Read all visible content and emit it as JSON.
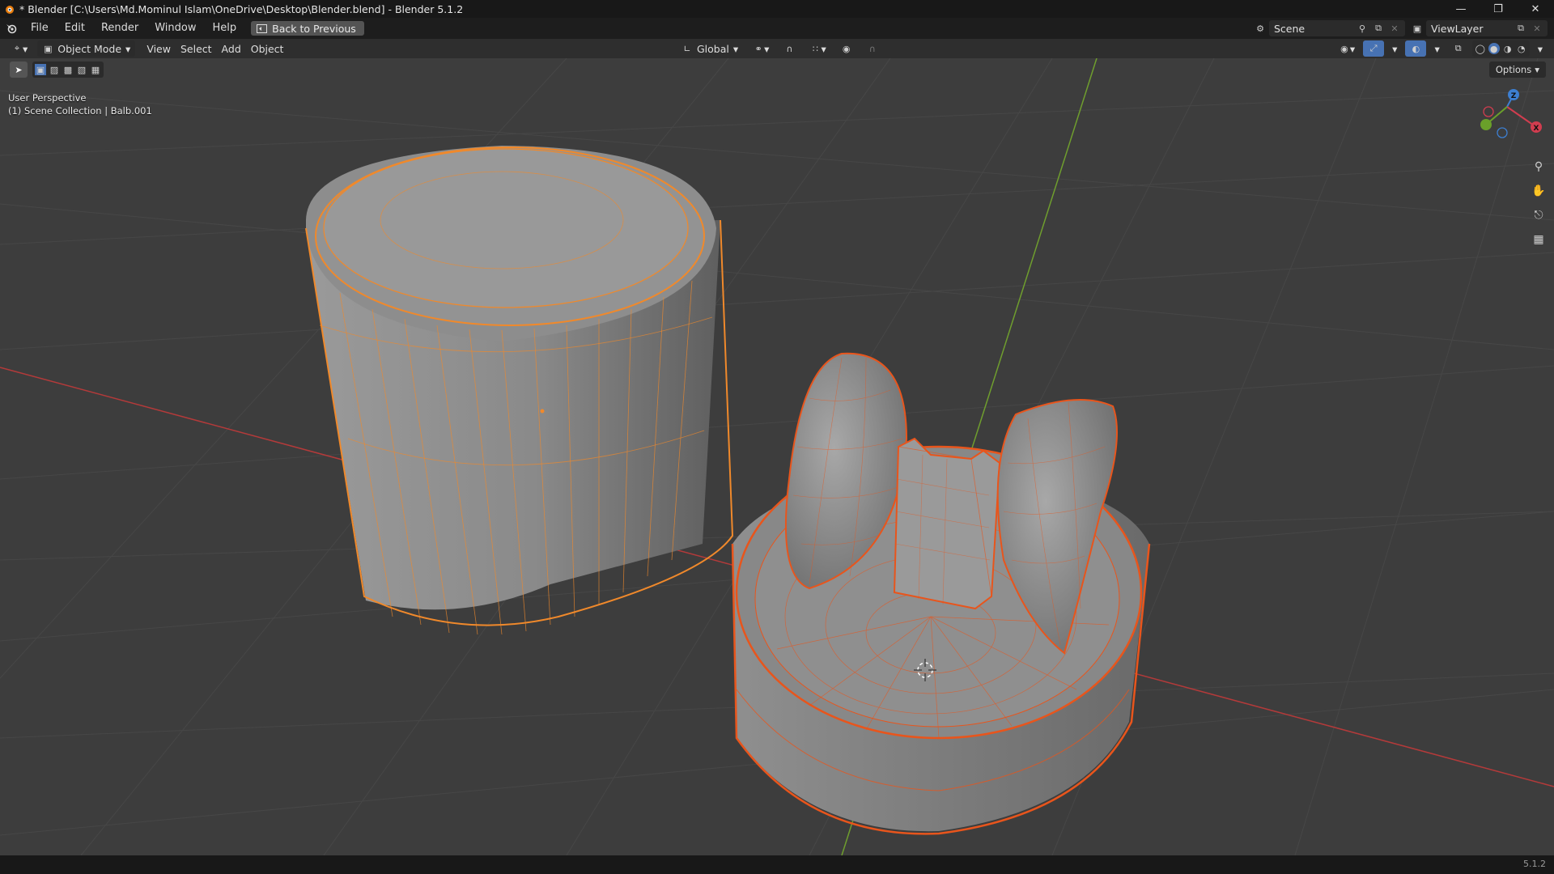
{
  "window": {
    "title": "* Blender [C:\\Users\\Md.Mominul Islam\\OneDrive\\Desktop\\Blender.blend] - Blender 5.1.2",
    "controls": [
      "minimize",
      "restore",
      "close"
    ]
  },
  "menubar": {
    "items": [
      "File",
      "Edit",
      "Render",
      "Window",
      "Help"
    ],
    "back_button": "Back to Previous",
    "scene": "Scene",
    "view_layer": "ViewLayer"
  },
  "viewport_header": {
    "mode": "Object Mode",
    "menus": [
      "View",
      "Select",
      "Add",
      "Object"
    ],
    "transform_orientation": "Global"
  },
  "viewport": {
    "perspective_label": "User Perspective",
    "collection_label": "(1) Scene Collection | Balb.001",
    "options_label": "Options",
    "gizmo_axes": [
      "X",
      "Y",
      "Z"
    ],
    "colors": {
      "background": "#3d3d3d",
      "grid_line": "#474747",
      "x_axis": "#b43a3a",
      "y_axis": "#6f9e2e",
      "selected_outline": "#f0892b",
      "active_outline": "#e8551c",
      "mesh_fill": "#8a8a8a"
    }
  },
  "statusbar": {
    "version": "5.1.2"
  }
}
